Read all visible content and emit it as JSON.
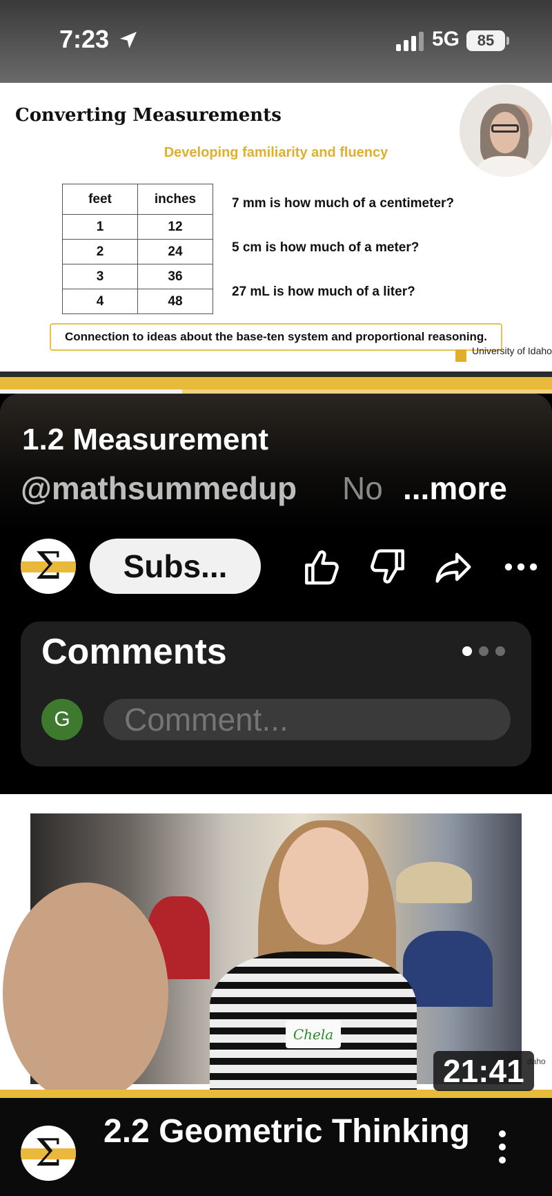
{
  "status_bar": {
    "time": "7:23",
    "network": "5G",
    "battery": "85"
  },
  "slide": {
    "title": "Converting Measurements",
    "subtitle": "Developing familiarity and fluency",
    "table": {
      "headers": [
        "feet",
        "inches"
      ],
      "rows": [
        [
          "1",
          "12"
        ],
        [
          "2",
          "24"
        ],
        [
          "3",
          "36"
        ],
        [
          "4",
          "48"
        ]
      ]
    },
    "questions": [
      "7 mm is how much of a centimeter?",
      "5 cm is how much of a meter?",
      "27 mL is how much of a liter?"
    ],
    "connection": "Connection to ideas about the base-ten system and proportional reasoning.",
    "logo_text": "University of Idaho"
  },
  "player": {
    "progress_fraction": 0.33
  },
  "video": {
    "title": "1.2 Measurement",
    "channel_handle": "@mathsummedup",
    "description_preview": "No",
    "more_label": "...more",
    "subscribe_label": "Subs...",
    "channel_avatar_glyph": "Σ"
  },
  "comments": {
    "title": "Comments",
    "user_initial": "G",
    "placeholder": "Comment..."
  },
  "next_video": {
    "duration": "21:41",
    "title": "2.2 Geometric Thinking",
    "thumbnail_edge_text": "daho",
    "name_tag": "Chela"
  },
  "colors": {
    "accent_gold": "#e8b93a",
    "avatar_green": "#3d7a2e"
  }
}
